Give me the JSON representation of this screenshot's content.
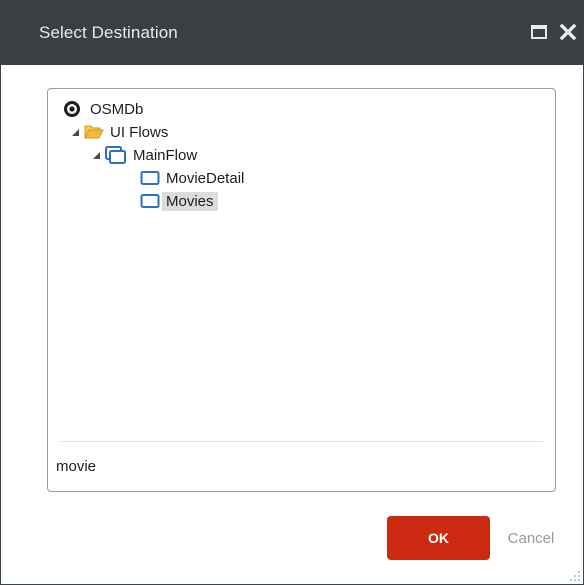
{
  "dialog": {
    "title": "Select Destination",
    "window_controls": [
      "maximize-icon",
      "close-icon"
    ]
  },
  "tree": {
    "items": [
      {
        "label": "OSMDb",
        "icon": "module-radio-icon",
        "level": 0,
        "expanded": true
      },
      {
        "label": "UI Flows",
        "icon": "folder-open-icon",
        "level": 1,
        "expanded": true
      },
      {
        "label": "MainFlow",
        "icon": "flow-icon",
        "level": 2,
        "expanded": true
      },
      {
        "label": "MovieDetail",
        "icon": "screen-icon",
        "level": 3
      },
      {
        "label": "Movies",
        "icon": "screen-icon",
        "level": 3,
        "selected": true
      }
    ]
  },
  "filter": {
    "value": "movie"
  },
  "buttons": {
    "ok_label": "OK",
    "cancel_label": "Cancel"
  },
  "colors": {
    "titlebar": "#3a3f44",
    "title_text": "#e9eaeb",
    "ok_button": "#cc2a10",
    "folder": "#f5b936",
    "screen_icon": "#2f6fc4",
    "selected_bg": "#dcdcdc"
  }
}
